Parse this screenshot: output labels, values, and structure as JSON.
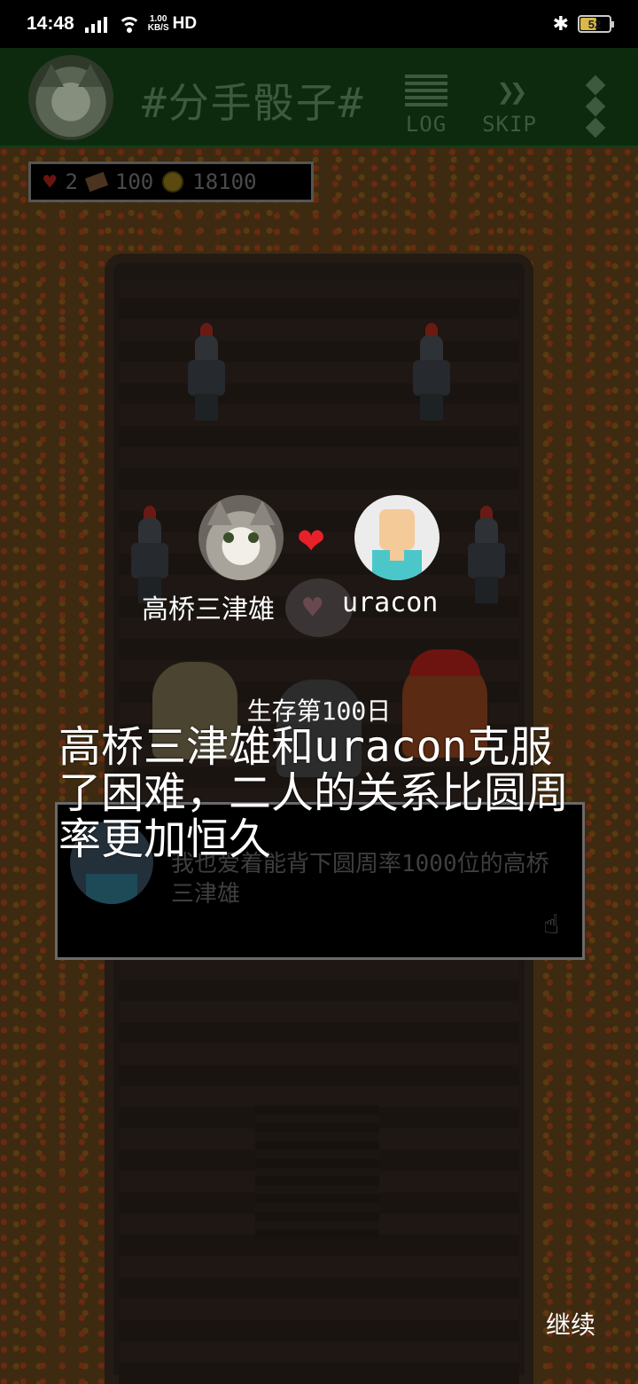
{
  "status_bar": {
    "time": "14:48",
    "network": "4G",
    "speed_value": "1.00",
    "speed_unit": "KB/S",
    "hd": "HD",
    "battery": "52"
  },
  "top_bar": {
    "title": "#分手骰子#",
    "log_label": "LOG",
    "skip_label": "SKIP"
  },
  "stats": {
    "hearts": "2",
    "tickets": "100",
    "coins": "18100"
  },
  "couple": {
    "left_name": "高桥三津雄",
    "right_name": "uracon"
  },
  "event": {
    "day_line": "生存第100日",
    "message": "高桥三津雄和uracon克服了困难，二人的关系比圆周率更加恒久"
  },
  "dialog": {
    "text": "我也爱着能背下圆周率1000位的高桥三津雄"
  },
  "continue_label": "继续",
  "colors": {
    "topbar_bg": "#0d2a0e",
    "heart": "#e8202a",
    "avatar_shirt": "#4bc7c9"
  },
  "icons": [
    "bluetooth-icon",
    "wifi-icon",
    "log-icon",
    "skip-icon",
    "menu-icon",
    "heart-icon",
    "ticket-icon",
    "coin-icon",
    "pointer-hand-icon"
  ]
}
